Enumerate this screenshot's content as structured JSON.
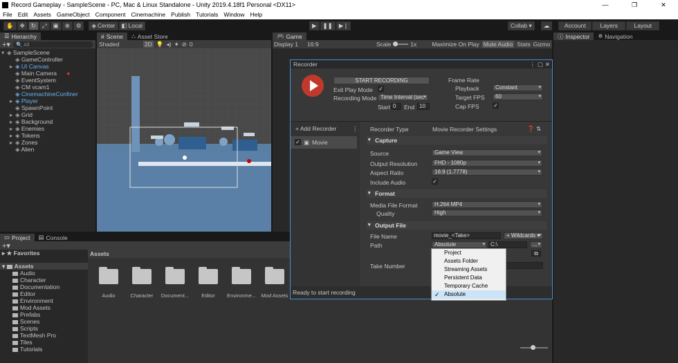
{
  "window": {
    "title": "Record Gameplay - SampleScene - PC, Mac & Linux Standalone - Unity 2019.4.18f1 Personal <DX11>",
    "minimize": "—",
    "restore": "❐",
    "close": "✕"
  },
  "menu": [
    "File",
    "Edit",
    "Assets",
    "GameObject",
    "Component",
    "Cinemachine",
    "Publish",
    "Tutorials",
    "Window",
    "Help"
  ],
  "toolbar": {
    "center": "Center",
    "local": "Local",
    "collab": "Collab ▾",
    "account": "Account",
    "layers": "Layers",
    "layout": "Layout"
  },
  "hierarchy": {
    "tab": "Hierarchy",
    "search_placeholder": "All",
    "items": [
      {
        "label": "SampleScene",
        "indent": 0,
        "blue": false,
        "arrow": "▾"
      },
      {
        "label": "GameController",
        "indent": 1,
        "blue": false,
        "arrow": ""
      },
      {
        "label": "UI Canvas",
        "indent": 1,
        "blue": true,
        "arrow": "▸"
      },
      {
        "label": "Main Camera",
        "indent": 1,
        "blue": false,
        "arrow": ""
      },
      {
        "label": "EventSystem",
        "indent": 1,
        "blue": false,
        "arrow": ""
      },
      {
        "label": "CM vcam1",
        "indent": 1,
        "blue": false,
        "arrow": ""
      },
      {
        "label": "CinemachineConfiner",
        "indent": 1,
        "blue": true,
        "arrow": ""
      },
      {
        "label": "Player",
        "indent": 1,
        "blue": true,
        "arrow": "▸"
      },
      {
        "label": "SpawnPoint",
        "indent": 1,
        "blue": false,
        "arrow": ""
      },
      {
        "label": "Grid",
        "indent": 1,
        "blue": false,
        "arrow": "▸"
      },
      {
        "label": "Background",
        "indent": 1,
        "blue": false,
        "arrow": "▸"
      },
      {
        "label": "Enemies",
        "indent": 1,
        "blue": false,
        "arrow": "▸"
      },
      {
        "label": "Tokens",
        "indent": 1,
        "blue": false,
        "arrow": "▸"
      },
      {
        "label": "Zones",
        "indent": 1,
        "blue": false,
        "arrow": "▸"
      },
      {
        "label": "Alien",
        "indent": 1,
        "blue": false,
        "arrow": ""
      }
    ]
  },
  "scene": {
    "tab": "Scene",
    "asset_store_tab": "Asset Store",
    "shading": "Shaded",
    "mode2d": "2D",
    "gizmo_count": "0"
  },
  "game": {
    "tab": "Game",
    "display": "Display 1",
    "aspect": "16:9",
    "scale_label": "Scale",
    "scale_value": "1x",
    "maximize": "Maximize On Play",
    "mute": "Mute Audio",
    "stats": "Stats",
    "gizmos": "Gizmo"
  },
  "inspector": {
    "tab": "Inspector",
    "navigation_tab": "Navigation"
  },
  "project": {
    "tab": "Project",
    "console_tab": "Console",
    "favorites": "Favorites",
    "assets_root": "Assets",
    "tree": [
      "Audio",
      "Character",
      "Documentation",
      "Editor",
      "Environment",
      "Mod Assets",
      "Prefabs",
      "Scenes",
      "Scripts",
      "TextMesh Pro",
      "Tiles",
      "Tutorials"
    ],
    "breadcrumb": "Assets",
    "grid": [
      "Audio",
      "Character",
      "Document...",
      "Editor",
      "Environme...",
      "Mod Assets"
    ]
  },
  "recorder": {
    "title": "Recorder",
    "start": "START RECORDING",
    "exit_play_mode": "Exit Play Mode",
    "recording_mode_label": "Recording Mode",
    "recording_mode": "Time Interval (sec",
    "start_label": "Start",
    "start_value": "0",
    "end_label": "End",
    "end_value": "10",
    "frame_rate": "Frame Rate",
    "playback_label": "Playback",
    "playback": "Constant",
    "target_fps_label": "Target FPS",
    "target_fps": "60",
    "cap_fps_label": "Cap FPS",
    "add_recorder": "+ Add Recorder",
    "list_item": "Movie",
    "recorder_type_label": "Recorder Type",
    "recorder_type": "Movie Recorder Settings",
    "capture": "Capture",
    "source_label": "Source",
    "source": "Game View",
    "output_res_label": "Output Resolution",
    "output_res": "FHD - 1080p",
    "aspect_label": "Aspect Ratio",
    "aspect": "16:9 (1.7778)",
    "include_audio_label": "Include Audio",
    "format": "Format",
    "media_format_label": "Media File Format",
    "media_format": "H.264 MP4",
    "quality_label": "Quality",
    "quality": "High",
    "output_file": "Output File",
    "file_name_label": "File Name",
    "file_name": "movie_<Take>",
    "wildcards": "+ Wildcards ▾",
    "path_label": "Path",
    "path_type": "Absolute",
    "path_value": "C:\\",
    "browse": "...",
    "take_label": "Take Number",
    "status": "Ready to start recording"
  },
  "path_popup": {
    "options": [
      "Project",
      "Assets Folder",
      "Streaming Assets",
      "Persistent Data",
      "Temporary Cache",
      "Absolute"
    ],
    "selected": "Absolute"
  },
  "colors": {
    "accent": "#4a8fd0",
    "record_red": "#c0392b",
    "sky": "#5b7fa3"
  }
}
